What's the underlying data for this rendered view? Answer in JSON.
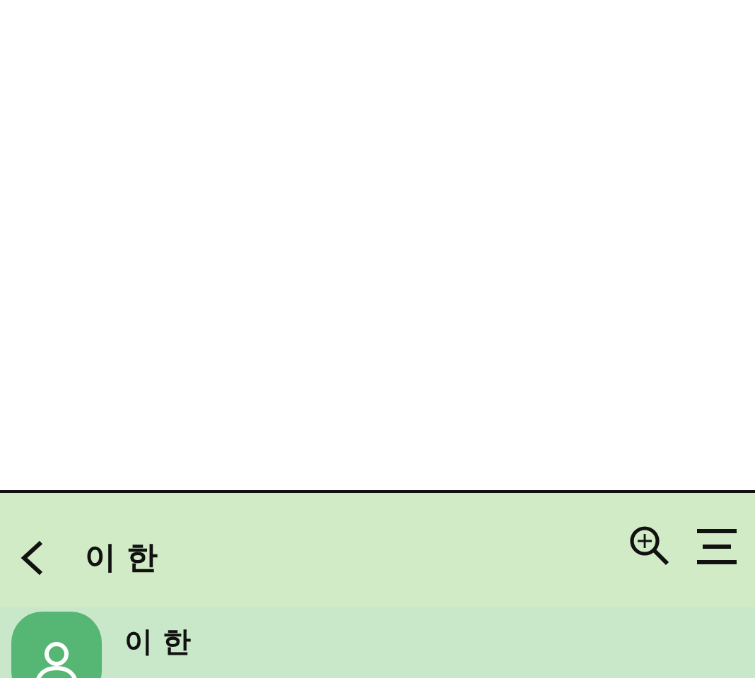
{
  "header": {
    "title": "이 한"
  },
  "contact": {
    "name": "이 한"
  }
}
